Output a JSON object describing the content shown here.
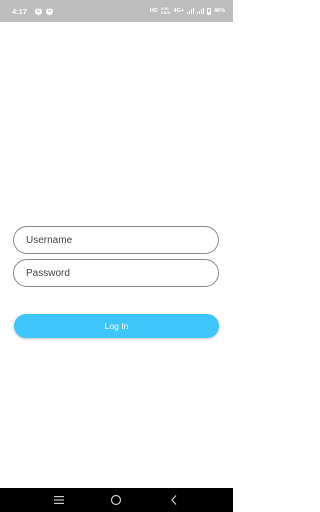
{
  "status_bar": {
    "time": "4:17",
    "app_icons": [
      "G",
      "G"
    ],
    "network_top": "HD",
    "network_speed_top": "0.00",
    "network_speed_bottom": "KB/S",
    "network_type": "4G+",
    "battery": "46%"
  },
  "login": {
    "username_placeholder": "Username",
    "password_placeholder": "Password",
    "button_label": "Log In",
    "button_color": "#3ec5fa"
  },
  "nav": {
    "icons": [
      "menu-icon",
      "home-icon",
      "back-icon"
    ]
  }
}
